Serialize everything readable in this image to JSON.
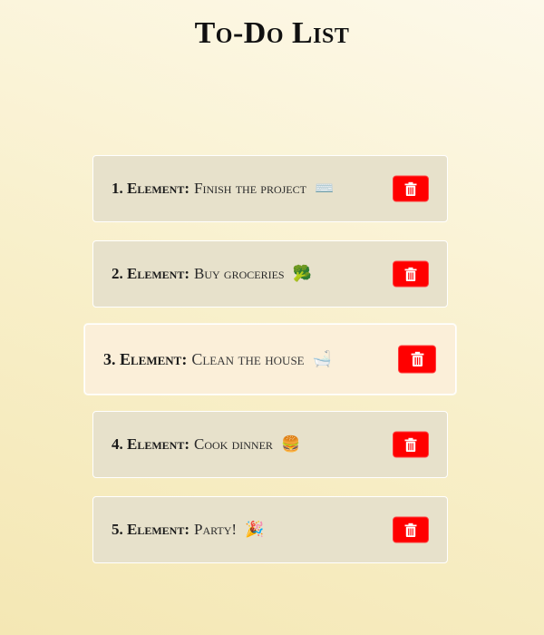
{
  "page": {
    "title": "To-Do List"
  },
  "colors": {
    "delete_button": "#ff0000",
    "item_background": "#e7e1cb",
    "hover_item_background": "#fbefd9"
  },
  "items": [
    {
      "label": "1. Element:",
      "text": "Finish the project",
      "emoji": "⌨️",
      "delete_icon": "trash-icon"
    },
    {
      "label": "2. Element:",
      "text": "Buy groceries",
      "emoji": "🥦",
      "delete_icon": "trash-icon"
    },
    {
      "label": "3. Element:",
      "text": "Clean the house",
      "emoji": "🛁",
      "delete_icon": "trash-icon"
    },
    {
      "label": "4. Element:",
      "text": "Cook dinner",
      "emoji": "🍔",
      "delete_icon": "trash-icon"
    },
    {
      "label": "5. Element:",
      "text": "Party!",
      "emoji": "🎉",
      "delete_icon": "trash-icon"
    }
  ]
}
